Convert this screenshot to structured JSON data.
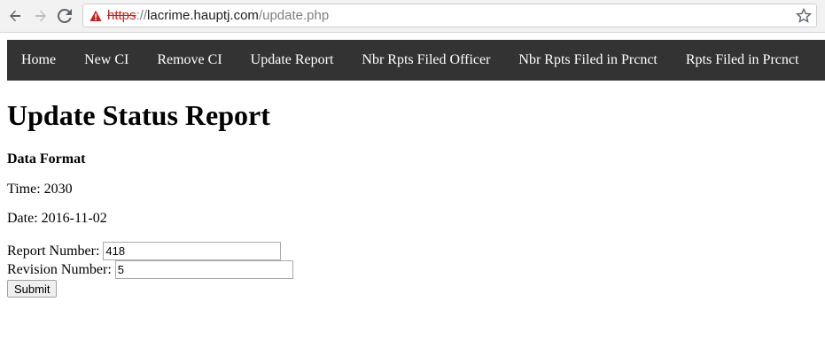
{
  "browser": {
    "url_scheme": "https",
    "url_sep": "://",
    "url_host": "lacrime.hauptj.com",
    "url_path": "/update.php"
  },
  "nav": {
    "items": [
      "Home",
      "New CI",
      "Remove CI",
      "Update Report",
      "Nbr Rpts Filed Officer",
      "Nbr Rpts Filed in Prcnct",
      "Rpts Filed in Prcnct"
    ]
  },
  "page": {
    "title": "Update Status Report",
    "data_format_label": "Data Format",
    "time_line": "Time: 2030",
    "date_line": "Date: 2016-11-02"
  },
  "form": {
    "report_label": "Report Number:",
    "report_value": "418",
    "revision_label": "Revision Number:",
    "revision_value": "5",
    "submit_label": "Submit"
  },
  "colors": {
    "navbar_bg": "#333333",
    "nav_text": "#ffffff",
    "warning": "#c5221f"
  }
}
